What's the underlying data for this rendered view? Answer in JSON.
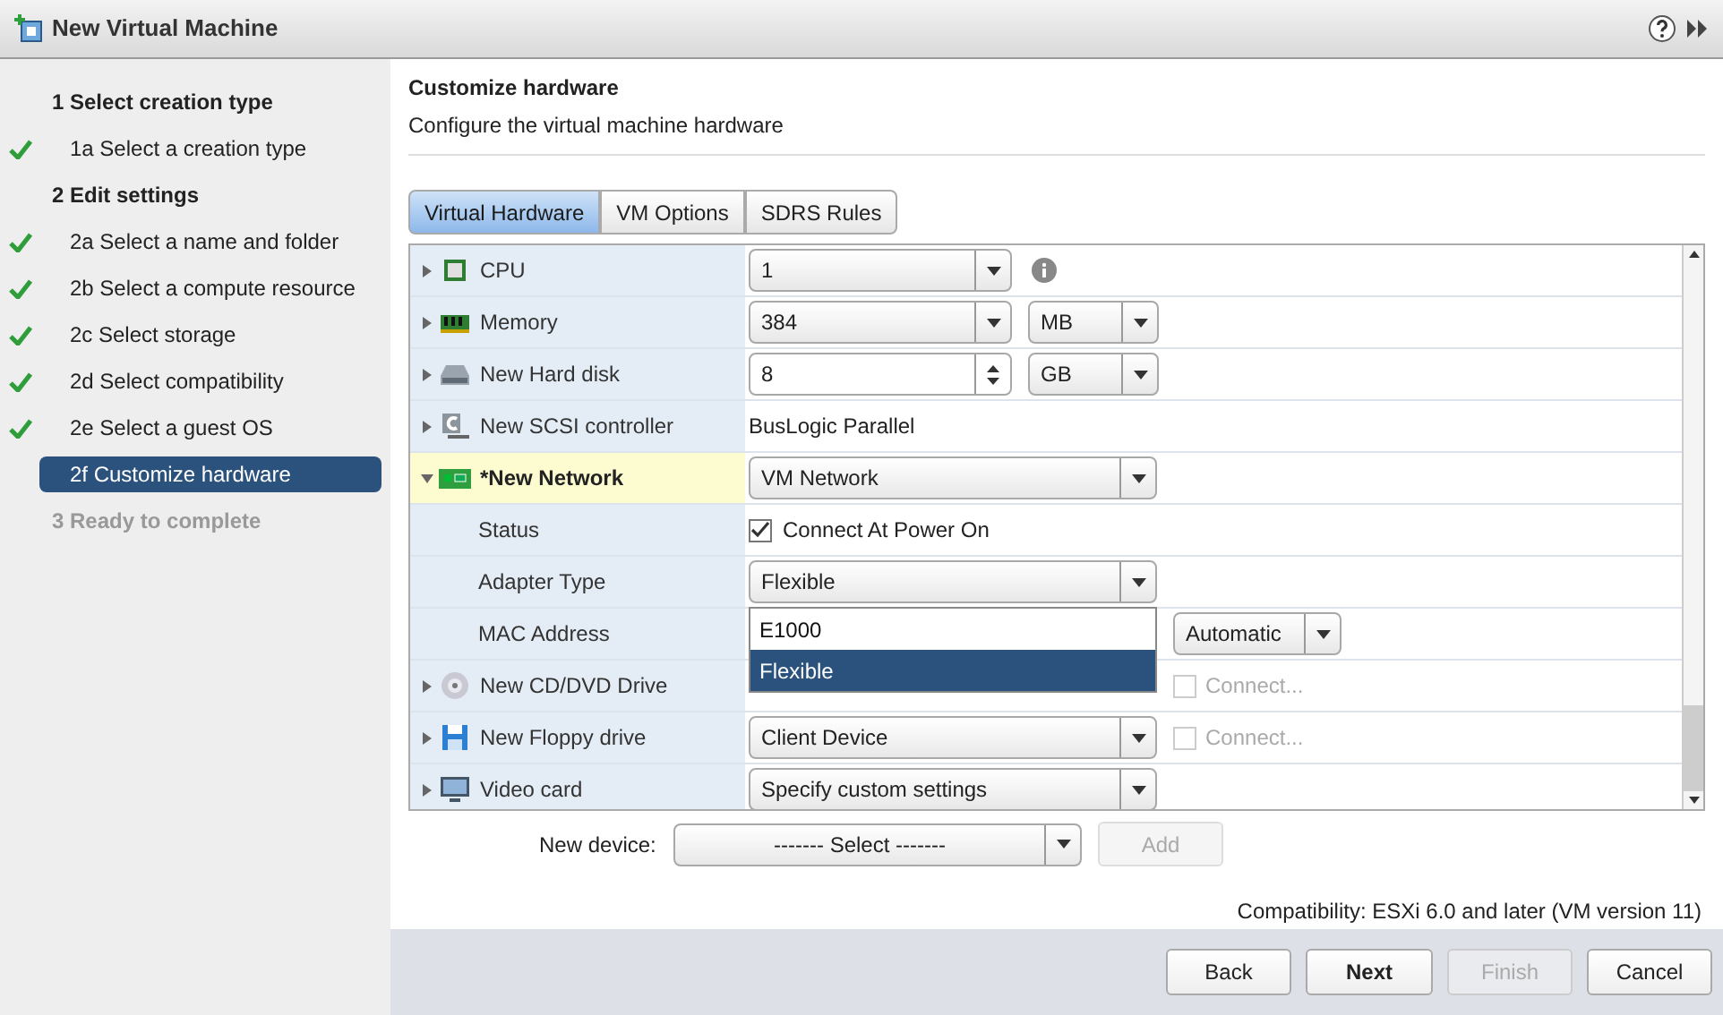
{
  "window": {
    "title": "New Virtual Machine"
  },
  "steps": [
    {
      "kind": "heading",
      "label": "1  Select creation type",
      "done": false,
      "selected": false,
      "disabled": false
    },
    {
      "kind": "substep",
      "label": "1a  Select a creation type",
      "done": true,
      "selected": false,
      "disabled": false
    },
    {
      "kind": "heading",
      "label": "2  Edit settings",
      "done": false,
      "selected": false,
      "disabled": false
    },
    {
      "kind": "substep",
      "label": "2a  Select a name and folder",
      "done": true,
      "selected": false,
      "disabled": false
    },
    {
      "kind": "substep",
      "label": "2b  Select a compute resource",
      "done": true,
      "selected": false,
      "disabled": false
    },
    {
      "kind": "substep",
      "label": "2c  Select storage",
      "done": true,
      "selected": false,
      "disabled": false
    },
    {
      "kind": "substep",
      "label": "2d  Select compatibility",
      "done": true,
      "selected": false,
      "disabled": false
    },
    {
      "kind": "substep",
      "label": "2e  Select a guest OS",
      "done": true,
      "selected": false,
      "disabled": false
    },
    {
      "kind": "substep",
      "label": "2f  Customize hardware",
      "done": false,
      "selected": true,
      "disabled": false
    },
    {
      "kind": "heading",
      "label": "3  Ready to complete",
      "done": false,
      "selected": false,
      "disabled": true
    }
  ],
  "page": {
    "title": "Customize hardware",
    "subtitle": "Configure the virtual machine hardware"
  },
  "tabs": [
    {
      "label": "Virtual Hardware",
      "selected": true
    },
    {
      "label": "VM Options",
      "selected": false
    },
    {
      "label": "SDRS Rules",
      "selected": false
    }
  ],
  "rows": [
    {
      "kind": "device",
      "label": "CPU",
      "expanded": false,
      "selected": false,
      "control": {
        "kind": "combo",
        "value": "1"
      },
      "info": true
    },
    {
      "kind": "device",
      "label": "Memory",
      "expanded": false,
      "selected": false,
      "control": {
        "kind": "combo",
        "value": "384"
      },
      "unit": "MB"
    },
    {
      "kind": "device",
      "label": "New Hard disk",
      "expanded": false,
      "selected": false,
      "control": {
        "kind": "spinner",
        "value": "8"
      },
      "unit": "GB"
    },
    {
      "kind": "device",
      "label": "New SCSI controller",
      "expanded": false,
      "selected": false,
      "control": {
        "kind": "text",
        "value": "BusLogic Parallel"
      }
    },
    {
      "kind": "device",
      "label": "*New Network",
      "expanded": true,
      "selected": true,
      "control": {
        "kind": "select",
        "value": "VM Network"
      }
    },
    {
      "kind": "property",
      "label": "Status",
      "control": {
        "kind": "checkbox",
        "value": "Connect At Power On",
        "checked": true,
        "disabled": false
      }
    },
    {
      "kind": "property",
      "label": "Adapter Type",
      "control": {
        "kind": "select",
        "value": "Flexible",
        "options": [
          {
            "label": "E1000",
            "selected": false
          },
          {
            "label": "Flexible",
            "selected": true
          }
        ]
      }
    },
    {
      "kind": "property",
      "label": "MAC Address",
      "control": {
        "kind": "covered"
      },
      "unit": "Automatic"
    },
    {
      "kind": "device",
      "label": "New CD/DVD Drive",
      "expanded": false,
      "selected": false,
      "control": {
        "kind": "covered"
      },
      "connect": {
        "label": "Connect...",
        "checked": false,
        "disabled": true
      }
    },
    {
      "kind": "device",
      "label": "New Floppy drive",
      "expanded": false,
      "selected": false,
      "control": {
        "kind": "select",
        "value": "Client Device"
      },
      "connect": {
        "label": "Connect...",
        "checked": false,
        "disabled": true
      }
    },
    {
      "kind": "device",
      "label": "Video card",
      "expanded": false,
      "selected": false,
      "control": {
        "kind": "select",
        "value": "Specify custom settings"
      }
    }
  ],
  "new_device": {
    "label": "New device:",
    "value": "------- Select -------",
    "add": {
      "label": "Add",
      "disabled": true
    }
  },
  "compatibility": "Compatibility: ESXi 6.0 and later (VM version 11)",
  "buttons": [
    {
      "label": "Back",
      "primary": false,
      "disabled": false
    },
    {
      "label": "Next",
      "primary": true,
      "disabled": false
    },
    {
      "label": "Finish",
      "primary": false,
      "disabled": true
    },
    {
      "label": "Cancel",
      "primary": false,
      "disabled": false
    }
  ]
}
